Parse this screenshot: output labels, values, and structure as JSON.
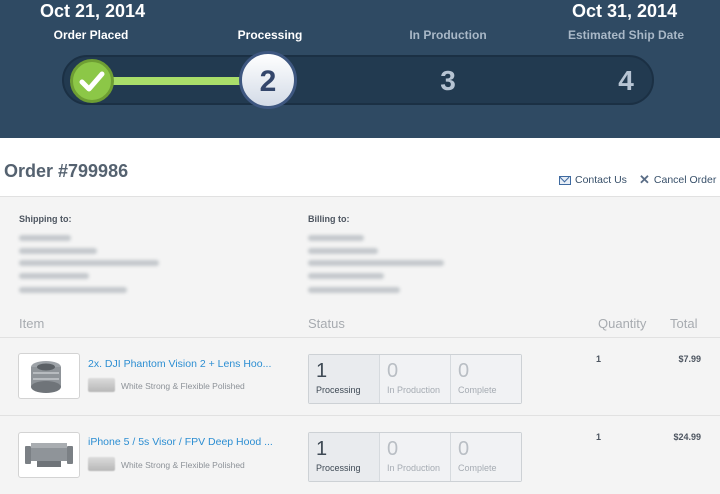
{
  "progress": {
    "start_date": "Oct 21, 2014",
    "end_date": "Oct 31, 2014",
    "steps": [
      {
        "label": "Order Placed",
        "number": "",
        "state": "done"
      },
      {
        "label": "Processing",
        "number": "2",
        "state": "active"
      },
      {
        "label": "In Production",
        "number": "3",
        "state": "pending"
      },
      {
        "label": "Estimated Ship Date",
        "number": "4",
        "state": "pending"
      }
    ]
  },
  "order": {
    "title": "Order #799986",
    "contact_label": "Contact Us",
    "cancel_label": "Cancel Order"
  },
  "addresses": {
    "shipping_label": "Shipping to:",
    "billing_label": "Billing to:"
  },
  "table": {
    "headers": {
      "item": "Item",
      "status": "Status",
      "quantity": "Quantity",
      "total": "Total"
    },
    "rows": [
      {
        "name": "2x. DJI Phantom Vision 2 + Lens Hoo...",
        "material": "White Strong & Flexible Polished",
        "icon": "lens-hood-icon",
        "status": [
          {
            "count": "1",
            "label": "Processing"
          },
          {
            "count": "0",
            "label": "In Production"
          },
          {
            "count": "0",
            "label": "Complete"
          }
        ],
        "quantity": "1",
        "total": "$7.99"
      },
      {
        "name": "iPhone 5 / 5s Visor / FPV Deep Hood ...",
        "material": "White Strong & Flexible Polished",
        "icon": "phone-visor-icon",
        "status": [
          {
            "count": "1",
            "label": "Processing"
          },
          {
            "count": "0",
            "label": "In Production"
          },
          {
            "count": "0",
            "label": "Complete"
          }
        ],
        "quantity": "1",
        "total": "$24.99"
      }
    ]
  },
  "colors": {
    "header_bg": "#2f4a63",
    "progress_fill": "#a9de6a",
    "done_green": "#8cc747",
    "link_blue": "#2c8ed2"
  }
}
